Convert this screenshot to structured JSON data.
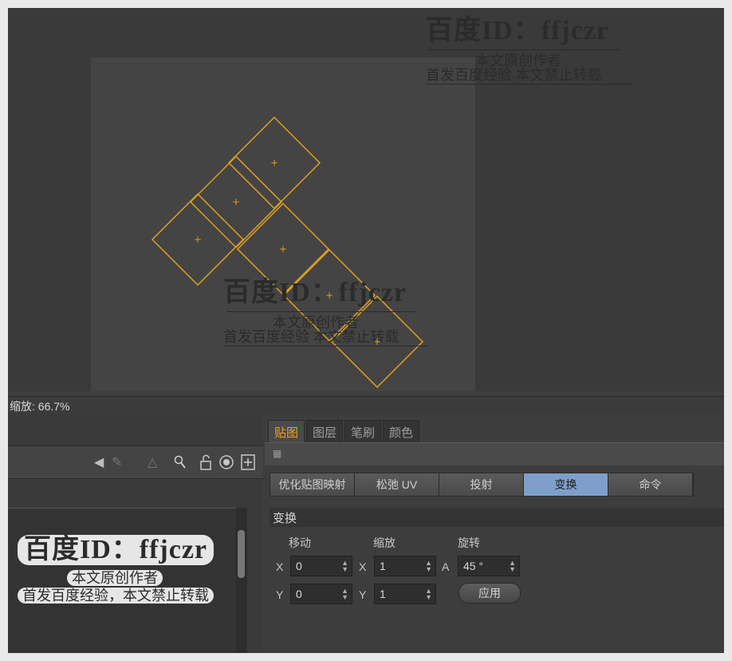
{
  "viewport": {
    "zoom_label": "缩放: 66.7%",
    "uv_color": "#e0a020"
  },
  "watermark": {
    "title": "百度ID：ffjczr",
    "line1": "本文原创作者",
    "line2": "首发百度经验  本文禁止转载",
    "line2_alt": "首发百度经验，本文禁止转载"
  },
  "toolbar_icons": [
    "arrow-left-icon",
    "pen-icon",
    "triangle-icon",
    "magnifier-icon",
    "unlock-icon",
    "target-icon",
    "plus-box-icon"
  ],
  "tabs": [
    {
      "label": "贴图",
      "active": true
    },
    {
      "label": "图层",
      "active": false
    },
    {
      "label": "笔刷",
      "active": false
    },
    {
      "label": "颜色",
      "active": false
    }
  ],
  "commands": [
    {
      "label": "优化贴图映射",
      "active": false
    },
    {
      "label": "松弛 UV",
      "active": false
    },
    {
      "label": "投射",
      "active": false
    },
    {
      "label": "变换",
      "active": true
    },
    {
      "label": "命令",
      "active": false
    }
  ],
  "transform": {
    "section_title": "变换",
    "move_label": "移动",
    "scale_label": "缩放",
    "rotate_label": "旋转",
    "move_x_axis": "X",
    "move_y_axis": "Y",
    "scale_x_axis": "X",
    "scale_y_axis": "Y",
    "rotate_axis": "A",
    "move_x": "0",
    "move_y": "0",
    "scale_x": "1",
    "scale_y": "1",
    "rotate_a": "45 °",
    "apply_label": "应用"
  },
  "colors": {
    "accent": "#f0a020",
    "active_button": "#7f9fcb",
    "panel": "#3d3d3d"
  }
}
